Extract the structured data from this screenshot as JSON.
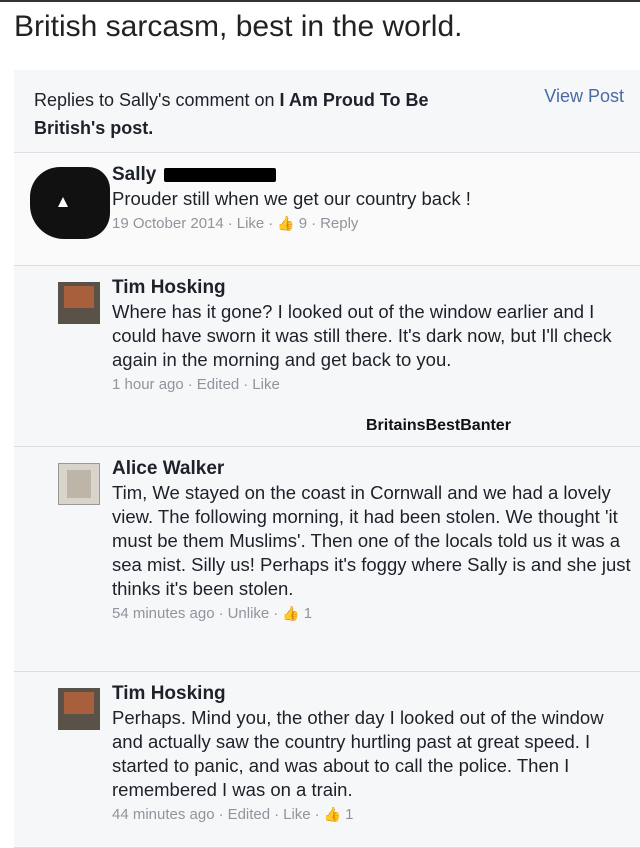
{
  "caption": "British sarcasm, best in the world.",
  "header": {
    "replies_prefix": "Replies to Sally's comment on ",
    "page_name": "I Am Proud To Be British",
    "replies_suffix": "'s post.",
    "view_post": "View Post"
  },
  "comments": [
    {
      "name": "Sally",
      "text": "Prouder still when we get our country back !",
      "date": "19 October 2014",
      "action": "Like",
      "likes": "9",
      "reply": "Reply"
    },
    {
      "name": "Tim Hosking",
      "text": "Where has it gone? I looked out of the window earlier and I could have sworn it was still there. It's dark now, but I'll check again in the morning and get back to you.",
      "time": "1 hour ago",
      "edited": "Edited",
      "action": "Like"
    },
    {
      "name": "Alice Walker",
      "text": "Tim, We stayed on the coast in Cornwall and we had a lovely view. The following morning, it had been stolen. We thought 'it must be them Muslims'. Then one of the locals told us it was a sea mist. Silly us! Perhaps it's foggy where Sally is and she just thinks it's been stolen.",
      "time": "54 minutes ago",
      "action": "Unlike",
      "likes": "1"
    },
    {
      "name": "Tim Hosking",
      "text": "Perhaps. Mind you, the other day I looked out of the window and actually saw the country hurtling past at great speed. I started to panic, and was about to call the police. Then I remembered I was on a train.",
      "time": "44 minutes ago",
      "edited": "Edited",
      "action": "Like",
      "likes": "1"
    }
  ],
  "watermark": "BritainsBestBanter"
}
